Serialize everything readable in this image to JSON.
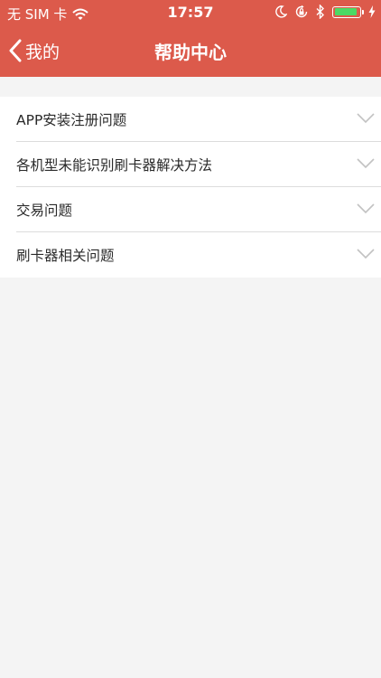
{
  "status_bar": {
    "carrier": "无 SIM 卡",
    "time": "17:57"
  },
  "nav": {
    "back_label": "我的",
    "title": "帮助中心"
  },
  "help_items": [
    {
      "label": "APP安装注册问题"
    },
    {
      "label": "各机型未能识别刷卡器解决方法"
    },
    {
      "label": "交易问题"
    },
    {
      "label": "刷卡器相关问题"
    }
  ],
  "colors": {
    "header_red": "#dc5a4b",
    "background": "#f4f4f4",
    "battery_green": "#4cd964"
  },
  "icons": {
    "status_bar": [
      "wifi-icon",
      "moon-icon",
      "orientation-lock-icon",
      "bluetooth-icon",
      "battery-icon",
      "charging-icon"
    ],
    "nav": [
      "chevron-left-icon"
    ],
    "list": [
      "chevron-down-icon"
    ]
  },
  "battery_level": 0.95
}
